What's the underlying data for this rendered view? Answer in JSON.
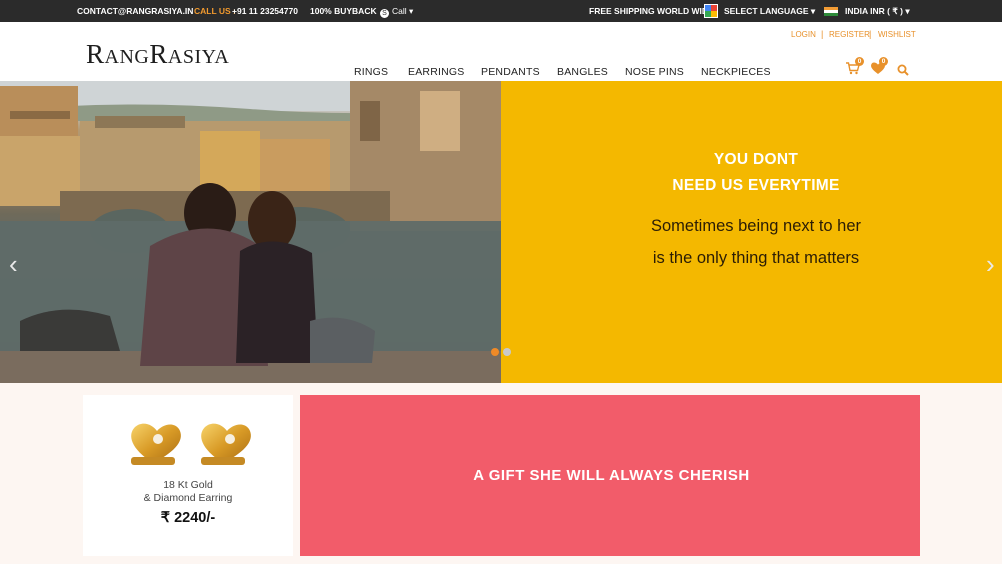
{
  "topbar": {
    "contact": "CONTACT@RANGRASIYA.IN",
    "call_label": "CALL US :",
    "phone": "+91 11 23254770",
    "buyback": "100% BUYBACK",
    "call_dropdown": "Call",
    "shipping": "FREE SHIPPING WORLD WIDE",
    "language": "SELECT LANGUAGE",
    "currency": "INDIA INR ( ₹ )"
  },
  "header": {
    "logo_first": "R",
    "logo_first_small": "ANG",
    "logo_second": "R",
    "logo_second_small": "ASIYA",
    "account": {
      "login": "LOGIN",
      "register": "REGISTER",
      "wishlist": "WISHLIST",
      "separator": "|"
    },
    "nav": [
      "RINGS",
      "EARRINGS",
      "PENDANTS",
      "BANGLES",
      "NOSE PINS",
      "NECKPIECES"
    ],
    "cart_count": "0",
    "wishlist_count": "0"
  },
  "hero": {
    "headline_line1": "YOU DONT",
    "headline_line2": "NEED US EVERYTIME",
    "sub_line1": "Sometimes being next to her",
    "sub_line2": "is the only thing that matters",
    "prev_arrow": "‹",
    "next_arrow": "›",
    "slide_count": 2,
    "active_slide": 1
  },
  "product": {
    "name_line1": "18 Kt Gold",
    "name_line2": "& Diamond Earring",
    "currency_symbol": "₹",
    "price": "2240/-"
  },
  "promo": {
    "text": "A GIFT SHE WILL ALWAYS CHERISH"
  },
  "icons": [
    "skype-icon",
    "translate-icon",
    "india-flag-icon",
    "cart-icon",
    "heart-icon",
    "search-icon",
    "chevron-left-icon",
    "chevron-right-icon"
  ],
  "colors": {
    "accent": "#e8912b",
    "hero_yellow": "#f4b800",
    "promo_pink": "#f25c6a",
    "topbar": "#2b2b2b"
  }
}
